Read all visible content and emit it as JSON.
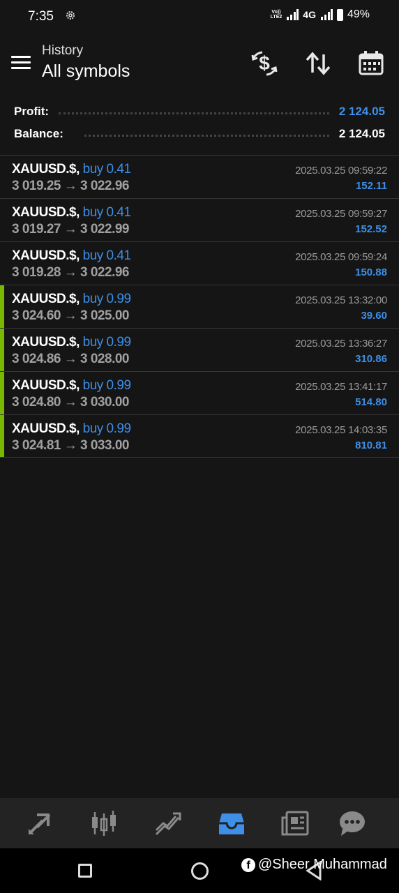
{
  "status": {
    "time": "7:35",
    "volte_line1": "Vo))",
    "volte_line2": "LTE2",
    "network": "4G",
    "battery": "49%"
  },
  "header": {
    "subtitle": "History",
    "title": "All symbols"
  },
  "summary": {
    "profit_label": "Profit:",
    "profit_value": "2 124.05",
    "balance_label": "Balance:",
    "balance_value": "2 124.05",
    "profit_color": "#3d8fe8"
  },
  "deals": [
    {
      "symbol": "XAUUSD.$,",
      "type": "buy 0.41",
      "prices": "3 019.25 → 3 022.96",
      "time": "2025.03.25 09:59:22",
      "profit": "152.11",
      "accent": false
    },
    {
      "symbol": "XAUUSD.$,",
      "type": "buy 0.41",
      "prices": "3 019.27 → 3 022.99",
      "time": "2025.03.25 09:59:27",
      "profit": "152.52",
      "accent": false
    },
    {
      "symbol": "XAUUSD.$,",
      "type": "buy 0.41",
      "prices": "3 019.28 → 3 022.96",
      "time": "2025.03.25 09:59:24",
      "profit": "150.88",
      "accent": false
    },
    {
      "symbol": "XAUUSD.$,",
      "type": "buy 0.99",
      "prices": "3 024.60 → 3 025.00",
      "time": "2025.03.25 13:32:00",
      "profit": "39.60",
      "accent": true
    },
    {
      "symbol": "XAUUSD.$,",
      "type": "buy 0.99",
      "prices": "3 024.86 → 3 028.00",
      "time": "2025.03.25 13:36:27",
      "profit": "310.86",
      "accent": true
    },
    {
      "symbol": "XAUUSD.$,",
      "type": "buy 0.99",
      "prices": "3 024.80 → 3 030.00",
      "time": "2025.03.25 13:41:17",
      "profit": "514.80",
      "accent": true
    },
    {
      "symbol": "XAUUSD.$,",
      "type": "buy 0.99",
      "prices": "3 024.81 → 3 033.00",
      "time": "2025.03.25 14:03:35",
      "profit": "810.81",
      "accent": true
    }
  ],
  "bottom_nav": {
    "items": [
      "quotes-icon",
      "chart-icon",
      "trade-icon",
      "history-icon",
      "news-icon",
      "messages-icon"
    ],
    "active": "history-icon",
    "active_color": "#3d8fe8"
  },
  "watermark": {
    "text": "@Sheer Muhammad"
  },
  "colors": {
    "background": "#151515",
    "accent_bar": "#7ab800",
    "blue": "#3d8fe8"
  }
}
